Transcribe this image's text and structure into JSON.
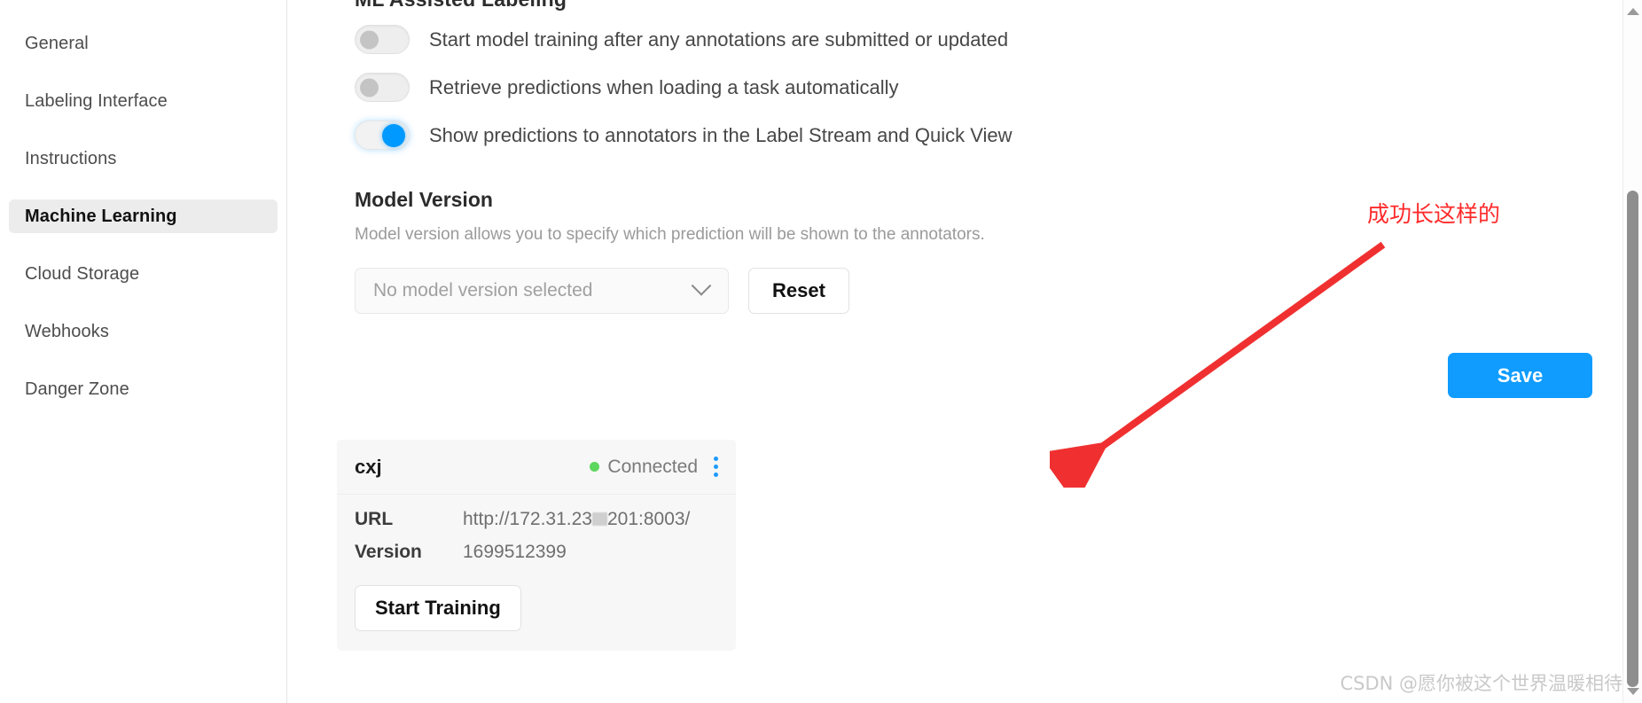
{
  "sidebar": {
    "items": [
      {
        "label": "General",
        "active": false
      },
      {
        "label": "Labeling Interface",
        "active": false
      },
      {
        "label": "Instructions",
        "active": false
      },
      {
        "label": "Machine Learning",
        "active": true
      },
      {
        "label": "Cloud Storage",
        "active": false
      },
      {
        "label": "Webhooks",
        "active": false
      },
      {
        "label": "Danger Zone",
        "active": false
      }
    ]
  },
  "main": {
    "section_title": "ML Assisted Labeling",
    "toggles": [
      {
        "label": "Start model training after any annotations are submitted or updated",
        "state": "off"
      },
      {
        "label": "Retrieve predictions when loading a task automatically",
        "state": "off"
      },
      {
        "label": "Show predictions to annotators in the Label Stream and Quick View",
        "state": "on"
      }
    ],
    "model_version": {
      "title": "Model Version",
      "description": "Model version allows you to specify which prediction will be shown to the annotators.",
      "select_value": "No model version selected",
      "reset_label": "Reset"
    },
    "save_label": "Save",
    "model_card": {
      "name": "cxj",
      "status": "Connected",
      "status_color": "#5cd65c",
      "menu_icon": "vertical-dots-icon",
      "rows": [
        {
          "key": "URL",
          "value_before": "http://172.31.23",
          "value_after": "201:8003/",
          "redacted": true
        },
        {
          "key": "Version",
          "value_before": "1699512399",
          "value_after": "",
          "redacted": false
        }
      ],
      "train_label": "Start Training"
    }
  },
  "annotation": {
    "text": "成功长这样的",
    "color": "#ff2b2b",
    "arrow": "red-arrow-pointing-down-left"
  },
  "watermark": {
    "text": "CSDN @愿你被这个世界温暖相待"
  },
  "scrollbar": {
    "up_icon": "scroll-up-arrow-icon",
    "down_icon": "scroll-down-arrow-icon"
  },
  "colors": {
    "accent": "#109cff",
    "toggle_on": "#0099ff",
    "sidebar_active_bg": "#ececec",
    "card_bg": "#f7f7f7"
  }
}
